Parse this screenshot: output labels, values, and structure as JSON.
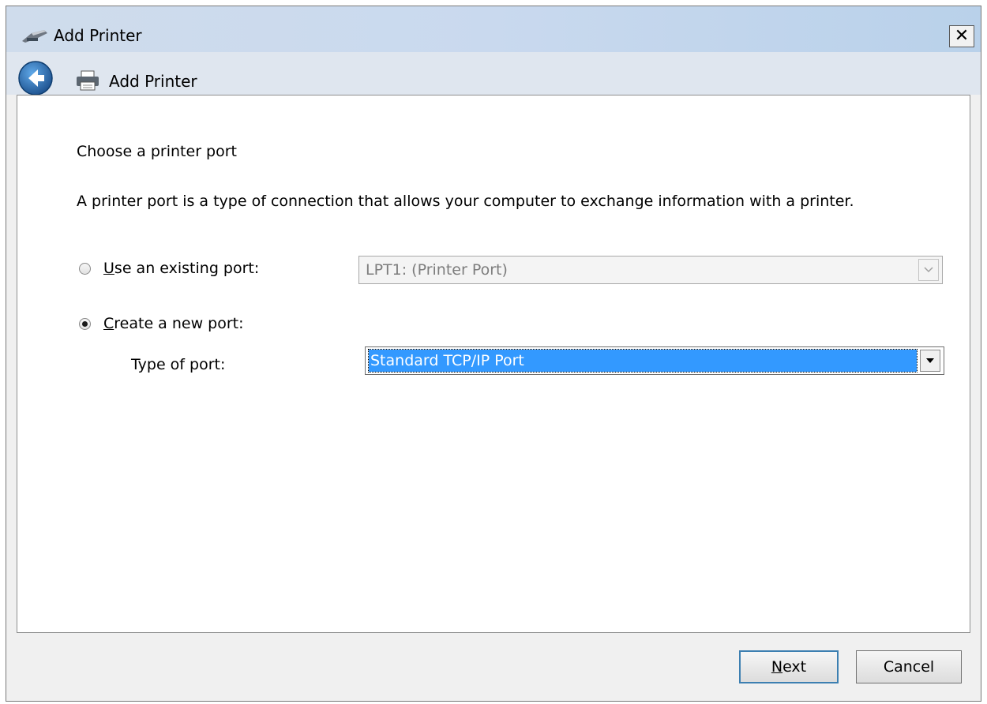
{
  "window": {
    "title": "Add Printer",
    "close_glyph": "✕"
  },
  "nav": {
    "title": "Add Printer",
    "back_icon": "back-arrow-icon",
    "printer_icon": "printer-icon"
  },
  "content": {
    "heading": "Choose a printer port",
    "description": "A printer port is a type of connection that allows your computer to exchange information with a printer.",
    "existing_port": {
      "label_accel": "U",
      "label_rest": "se an existing port:",
      "selected": false,
      "value": "LPT1: (Printer Port)"
    },
    "new_port": {
      "label_accel": "C",
      "label_rest": "reate a new port:",
      "selected": true,
      "type_label": "Type of port:",
      "value": "Standard TCP/IP Port"
    }
  },
  "buttons": {
    "next_accel": "N",
    "next_rest": "ext",
    "cancel": "Cancel"
  },
  "colors": {
    "selection": "#3399ff",
    "title_bar": "#c9d9ee"
  }
}
